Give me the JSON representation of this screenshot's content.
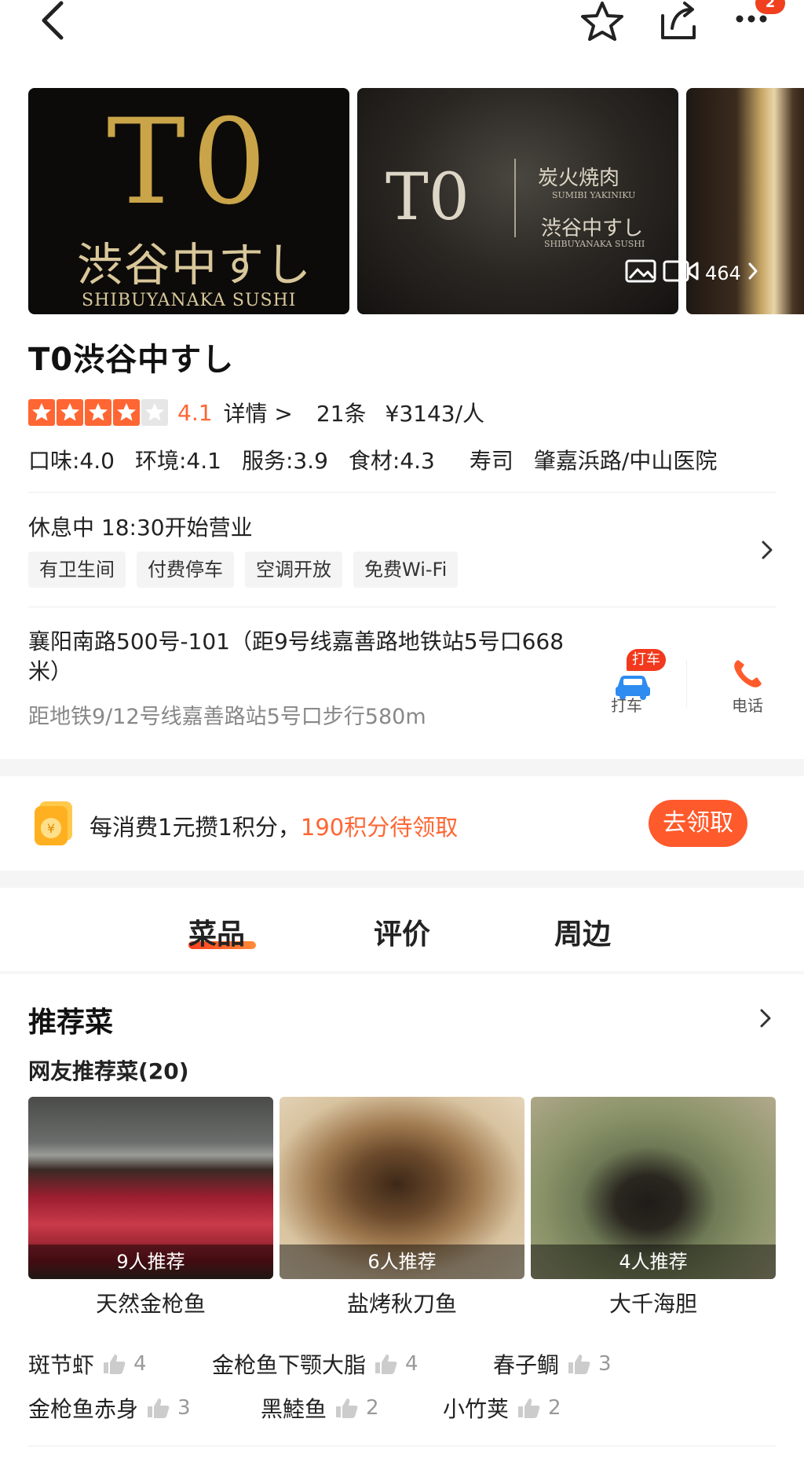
{
  "topbar": {
    "more_badge": "2"
  },
  "gallery": {
    "img1": {
      "logo": "T0",
      "jp": "渋谷中すし",
      "en": "SHIBUYANAKA SUSHI"
    },
    "img2": {
      "logo": "T0",
      "jp1": "炭火焼肉",
      "en1": "SUMIBI YAKINIKU",
      "jp2": "渋谷中すし",
      "en2": "SHIBUYANAKA SUSHI"
    },
    "media_count": "464"
  },
  "shop": {
    "name": "T0渋谷中すし",
    "rating": "4.1",
    "rating_stars": 4,
    "detail_link": "详情 >",
    "review_count": "21条",
    "price": "¥3143/人",
    "scores": [
      "口味:4.0",
      "环境:4.1",
      "服务:3.9",
      "食材:4.3"
    ],
    "category": "寿司",
    "area": "肇嘉浜路/中山医院"
  },
  "hours": {
    "status": "休息中 18:30开始营业"
  },
  "amenities": [
    "有卫生间",
    "付费停车",
    "空调开放",
    "免费Wi-Fi"
  ],
  "address": {
    "line": "襄阳南路500号-101（距9号线嘉善路地铁站5号口668米）",
    "sub": "距地铁9/12号线嘉善路站5号口步行580m",
    "taxi_badge": "打车",
    "taxi_label": "打车",
    "call_label": "电话"
  },
  "points": {
    "text": "每消费1元攒1积分，",
    "highlight": "190积分待领取",
    "button": "去领取"
  },
  "tabs": [
    "菜品",
    "评价",
    "周边"
  ],
  "recommend": {
    "title": "推荐菜",
    "subtitle": "网友推荐菜(20)",
    "dishes": [
      {
        "name": "天然金枪鱼",
        "count": "9人推荐"
      },
      {
        "name": "盐烤秋刀鱼",
        "count": "6人推荐"
      },
      {
        "name": "大千海胆",
        "count": "4人推荐"
      }
    ],
    "more": [
      {
        "name": "斑节虾",
        "count": "4"
      },
      {
        "name": "金枪鱼下颚大脂",
        "count": "4"
      },
      {
        "name": "春子鲷",
        "count": "3"
      },
      {
        "name": "金枪鱼赤身",
        "count": "3"
      },
      {
        "name": "黑鯥鱼",
        "count": "2"
      },
      {
        "name": "小竹荚",
        "count": "2"
      }
    ]
  },
  "colors": {
    "accent": "#ff6633",
    "button": "#ff5a2c",
    "badge": "#f0401f"
  }
}
